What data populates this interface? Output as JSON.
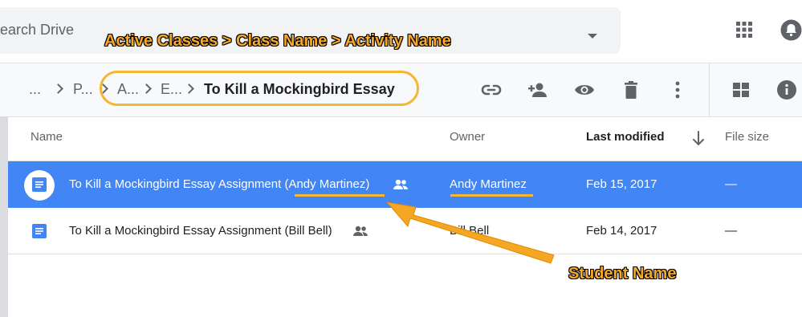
{
  "search": {
    "placeholder": "earch Drive"
  },
  "breadcrumb": {
    "items": [
      "...",
      "P...",
      "A...",
      "E..."
    ],
    "current": "To Kill a Mockingbird Essay"
  },
  "toolbar": {
    "icons": [
      "link-icon",
      "add-person-icon",
      "preview-icon",
      "trash-icon",
      "more-vert-icon",
      "grid-view-icon",
      "info-icon"
    ]
  },
  "table": {
    "headers": {
      "name": "Name",
      "owner": "Owner",
      "last_modified": "Last modified",
      "file_size": "File size"
    },
    "rows": [
      {
        "name": "To Kill a Mockingbird Essay Assignment (Andy Martinez)",
        "owner": "Andy Martinez",
        "modified": "Feb 15, 2017",
        "size": "—",
        "selected": true
      },
      {
        "name": "To Kill a Mockingbird Essay Assignment (Bill Bell)",
        "owner": "Bill Bell",
        "modified": "Feb 14, 2017",
        "size": "—",
        "selected": false
      }
    ]
  },
  "annotations": {
    "path_label": "Active Classes > Class Name > Activity Name",
    "student_label": "Student Name"
  },
  "colors": {
    "selected_row": "#4285f4",
    "annotation": "#f9a825",
    "doc_icon": "#4285f4"
  }
}
